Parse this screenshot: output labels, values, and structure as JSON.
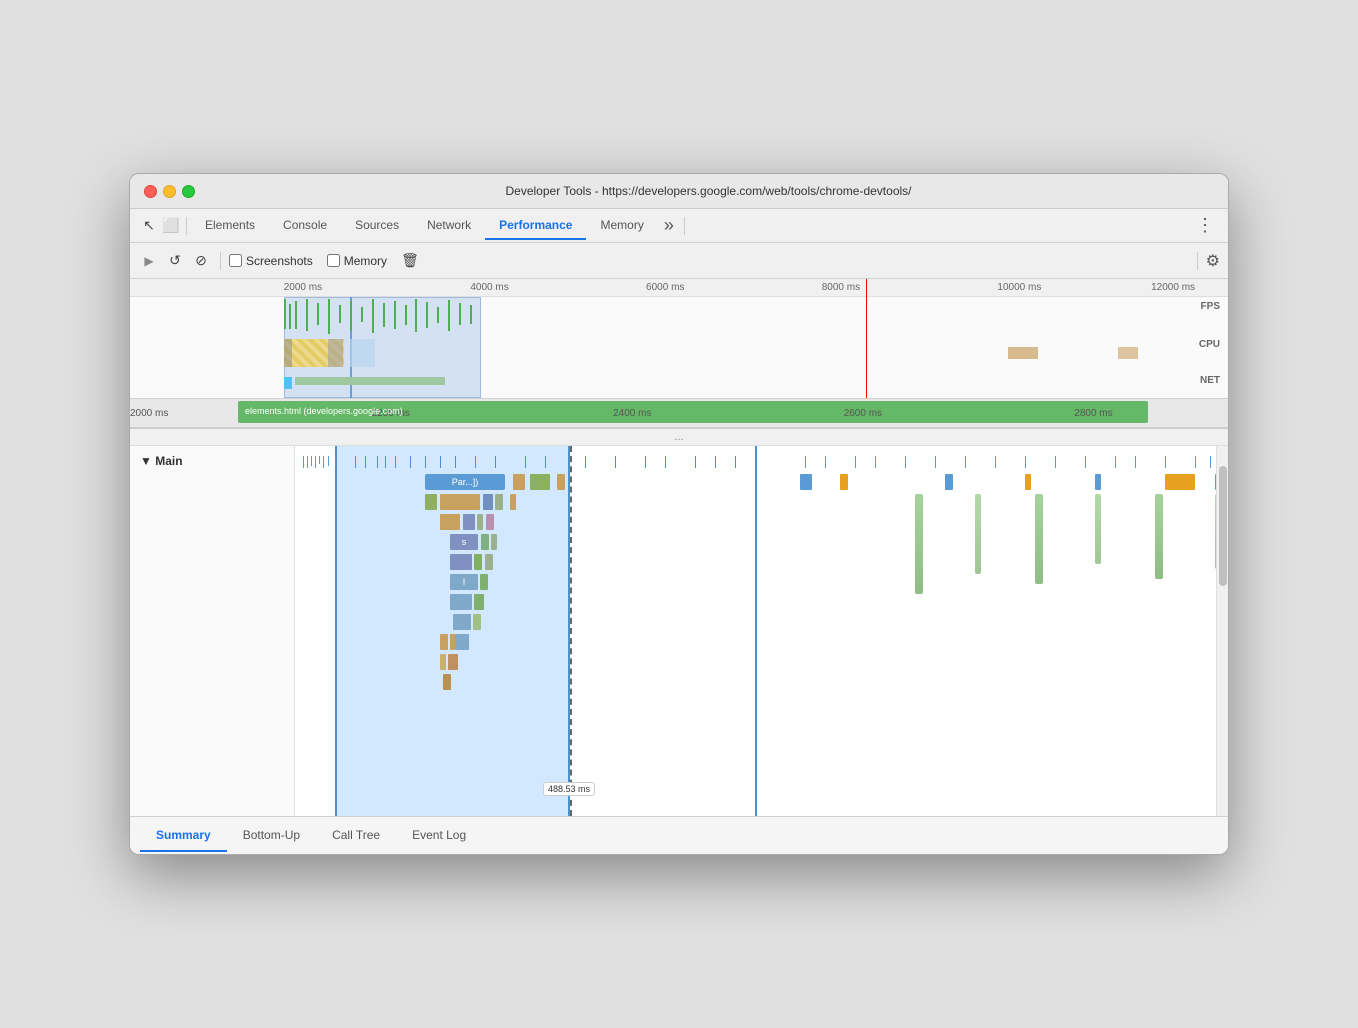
{
  "window": {
    "title": "Developer Tools - https://developers.google.com/web/tools/chrome-devtools/"
  },
  "tabs": {
    "items": [
      {
        "label": "Elements",
        "active": false
      },
      {
        "label": "Console",
        "active": false
      },
      {
        "label": "Sources",
        "active": false
      },
      {
        "label": "Network",
        "active": false
      },
      {
        "label": "Performance",
        "active": true
      },
      {
        "label": "Memory",
        "active": false
      }
    ],
    "overflow": "»",
    "more": "⋮"
  },
  "toolbar": {
    "record_label": "▶",
    "reload_label": "↺",
    "clear_label": "⊘",
    "screenshots_label": "Screenshots",
    "memory_label": "Memory",
    "trash_label": "🗑",
    "gear_label": "⚙"
  },
  "ruler": {
    "ticks": [
      "2000 ms",
      "4000 ms",
      "6000 ms",
      "8000 ms",
      "10000 ms",
      "12000 ms"
    ]
  },
  "zoom_ruler": {
    "ticks": [
      "2000 ms",
      "2200 ms",
      "2400 ms",
      "2600 ms",
      "2800 ms"
    ]
  },
  "labels": {
    "fps": "FPS",
    "cpu": "CPU",
    "net": "NET",
    "main": "▼ Main",
    "ellipsis": "...",
    "timestamp": "488.53 ms",
    "url": "elements.html (developers.google.com)"
  },
  "bottom_tabs": {
    "items": [
      {
        "label": "Summary",
        "active": true
      },
      {
        "label": "Bottom-Up",
        "active": false
      },
      {
        "label": "Call Tree",
        "active": false
      },
      {
        "label": "Event Log",
        "active": false
      }
    ]
  },
  "flame_chart": {
    "parse_label": "Par...])",
    "s_label": "s",
    "l_label": "l"
  },
  "icons": {
    "cursor": "↖",
    "dock": "⬜",
    "gear": "⚙",
    "checkbox": "☐",
    "triangle": "▶"
  }
}
